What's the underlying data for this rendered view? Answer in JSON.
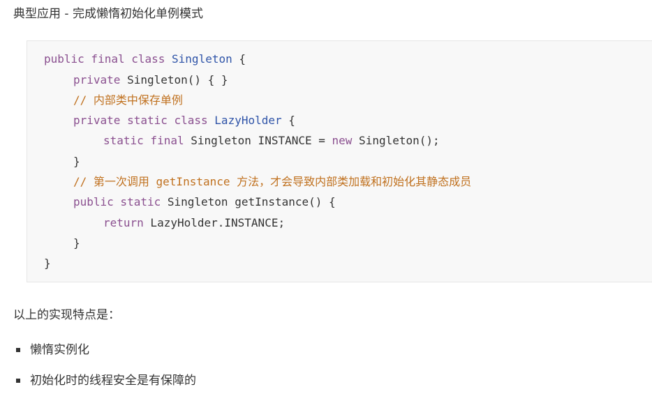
{
  "heading": "典型应用 - 完成懒惰初始化单例模式",
  "code": {
    "line1": {
      "t1": "public final class ",
      "t2": "Singleton",
      "t3": " {"
    },
    "line2": {
      "t1": "private",
      "t2": " Singleton() { }"
    },
    "line3": {
      "t1": "// 内部类中保存单例"
    },
    "line4": {
      "t1": "private static class ",
      "t2": "LazyHolder",
      "t3": " {"
    },
    "line5": {
      "t1": "static final",
      "t2": " Singleton INSTANCE = ",
      "t3": "new",
      "t4": " Singleton();"
    },
    "line6": {
      "t1": "}"
    },
    "line7": {
      "t1": "// 第一次调用 getInstance 方法，才会导致内部类加载和初始化其静态成员"
    },
    "line8": {
      "t1": "public static",
      "t2": " Singleton getInstance() {"
    },
    "line9": {
      "t1": "return",
      "t2": " LazyHolder.INSTANCE;"
    },
    "line10": {
      "t1": "}"
    },
    "line11": {
      "t1": "}"
    }
  },
  "paragraph": "以上的实现特点是：",
  "bullets": [
    "懒惰实例化",
    "初始化时的线程安全是有保障的"
  ]
}
